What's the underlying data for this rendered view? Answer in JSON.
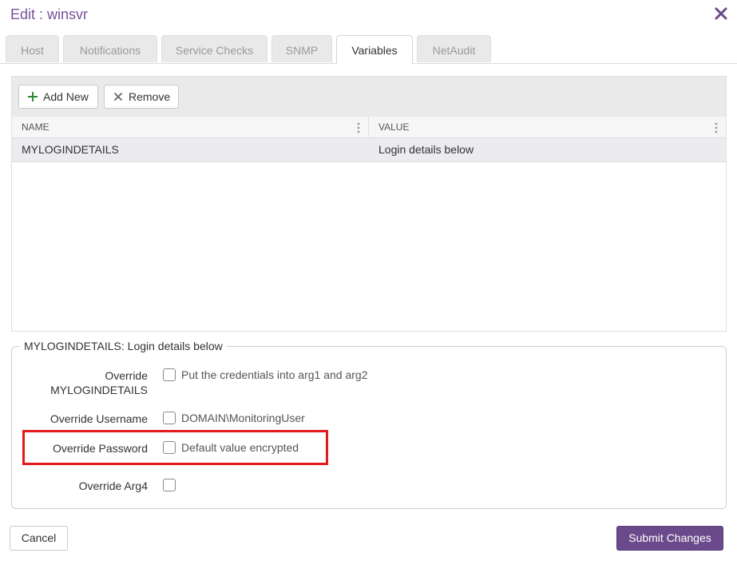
{
  "dialog": {
    "title": "Edit : winsvr"
  },
  "tabs": [
    {
      "label": "Host"
    },
    {
      "label": "Notifications"
    },
    {
      "label": "Service Checks"
    },
    {
      "label": "SNMP"
    },
    {
      "label": "Variables"
    },
    {
      "label": "NetAudit"
    }
  ],
  "active_tab": "Variables",
  "toolbar": {
    "add_label": "Add New",
    "remove_label": "Remove"
  },
  "grid": {
    "columns": [
      "NAME",
      "VALUE"
    ],
    "rows": [
      {
        "name": "MYLOGINDETAILS",
        "value": "Login details below"
      }
    ]
  },
  "detail": {
    "legend": "MYLOGINDETAILS: Login details below",
    "fields": [
      {
        "label_line1": "Override",
        "label_line2": "MYLOGINDETAILS",
        "hint": "Put the credentials into arg1 and arg2"
      },
      {
        "label": "Override Username",
        "hint": "DOMAIN\\MonitoringUser"
      },
      {
        "label": "Override Password",
        "hint": "Default value encrypted"
      },
      {
        "label": "Override Arg4",
        "hint": ""
      }
    ]
  },
  "footer": {
    "cancel_label": "Cancel",
    "submit_label": "Submit Changes"
  },
  "colors": {
    "accent": "#6b4a8b",
    "title": "#7a4f9a",
    "highlight": "#e31a1a"
  }
}
